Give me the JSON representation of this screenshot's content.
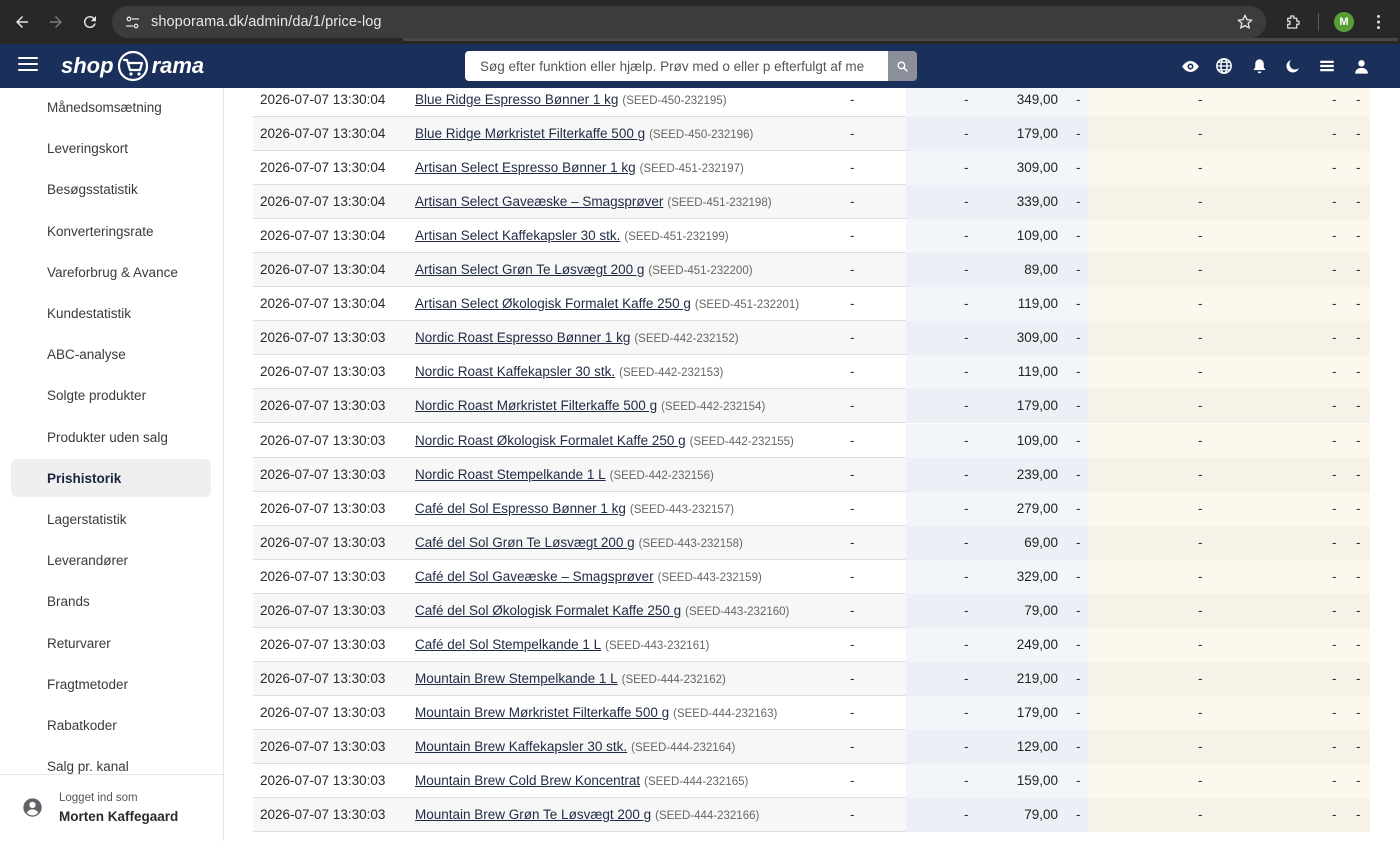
{
  "browser": {
    "url": "shoporama.dk/admin/da/1/price-log",
    "profile_initial": "M"
  },
  "header": {
    "logo_left": "shop",
    "logo_right": "rama",
    "search_placeholder": "Søg efter funktion eller hjælp. Prøv med o eller p efterfulgt af me",
    "icons": [
      "eye-icon",
      "globe-icon",
      "bell-icon",
      "moon-icon",
      "layers-icon",
      "user-icon"
    ],
    "colors": {
      "header_bg": "#1a2f5a",
      "browser_bg": "#282828"
    }
  },
  "sidebar": {
    "items": [
      {
        "label": "Månedsomsætning",
        "active": false
      },
      {
        "label": "Leveringskort",
        "active": false
      },
      {
        "label": "Besøgsstatistik",
        "active": false
      },
      {
        "label": "Konverteringsrate",
        "active": false
      },
      {
        "label": "Vareforbrug & Avance",
        "active": false
      },
      {
        "label": "Kundestatistik",
        "active": false
      },
      {
        "label": "ABC-analyse",
        "active": false
      },
      {
        "label": "Solgte produkter",
        "active": false
      },
      {
        "label": "Produkter uden salg",
        "active": false
      },
      {
        "label": "Prishistorik",
        "active": true
      },
      {
        "label": "Lagerstatistik",
        "active": false
      },
      {
        "label": "Leverandører",
        "active": false
      },
      {
        "label": "Brands",
        "active": false
      },
      {
        "label": "Returvarer",
        "active": false
      },
      {
        "label": "Fragtmetoder",
        "active": false
      },
      {
        "label": "Rabatkoder",
        "active": false
      },
      {
        "label": "Salg pr. kanal",
        "active": false
      }
    ],
    "user": {
      "label": "Logget ind som",
      "name": "Morten Kaffegaard"
    }
  },
  "table": {
    "dash": "-",
    "rows": [
      {
        "date": "2026-07-07 13:30:04",
        "product": "Blue Ridge Espresso Bønner 1 kg",
        "sku": "(SEED-450-232195)",
        "price": "349,00"
      },
      {
        "date": "2026-07-07 13:30:04",
        "product": "Blue Ridge Mørkristet Filterkaffe 500 g",
        "sku": "(SEED-450-232196)",
        "price": "179,00"
      },
      {
        "date": "2026-07-07 13:30:04",
        "product": "Artisan Select Espresso Bønner 1 kg",
        "sku": "(SEED-451-232197)",
        "price": "309,00"
      },
      {
        "date": "2026-07-07 13:30:04",
        "product": "Artisan Select Gaveæske – Smagsprøver",
        "sku": "(SEED-451-232198)",
        "price": "339,00"
      },
      {
        "date": "2026-07-07 13:30:04",
        "product": "Artisan Select Kaffekapsler 30 stk.",
        "sku": "(SEED-451-232199)",
        "price": "109,00"
      },
      {
        "date": "2026-07-07 13:30:04",
        "product": "Artisan Select Grøn Te Løsvægt 200 g",
        "sku": "(SEED-451-232200)",
        "price": "89,00"
      },
      {
        "date": "2026-07-07 13:30:04",
        "product": "Artisan Select Økologisk Formalet Kaffe 250 g",
        "sku": "(SEED-451-232201)",
        "price": "119,00"
      },
      {
        "date": "2026-07-07 13:30:03",
        "product": "Nordic Roast Espresso Bønner 1 kg",
        "sku": "(SEED-442-232152)",
        "price": "309,00"
      },
      {
        "date": "2026-07-07 13:30:03",
        "product": "Nordic Roast Kaffekapsler 30 stk.",
        "sku": "(SEED-442-232153)",
        "price": "119,00"
      },
      {
        "date": "2026-07-07 13:30:03",
        "product": "Nordic Roast Mørkristet Filterkaffe 500 g",
        "sku": "(SEED-442-232154)",
        "price": "179,00"
      },
      {
        "date": "2026-07-07 13:30:03",
        "product": "Nordic Roast Økologisk Formalet Kaffe 250 g",
        "sku": "(SEED-442-232155)",
        "price": "109,00"
      },
      {
        "date": "2026-07-07 13:30:03",
        "product": "Nordic Roast Stempelkande 1 L",
        "sku": "(SEED-442-232156)",
        "price": "239,00"
      },
      {
        "date": "2026-07-07 13:30:03",
        "product": "Café del Sol Espresso Bønner 1 kg",
        "sku": "(SEED-443-232157)",
        "price": "279,00"
      },
      {
        "date": "2026-07-07 13:30:03",
        "product": "Café del Sol Grøn Te Løsvægt 200 g",
        "sku": "(SEED-443-232158)",
        "price": "69,00"
      },
      {
        "date": "2026-07-07 13:30:03",
        "product": "Café del Sol Gaveæske – Smagsprøver",
        "sku": "(SEED-443-232159)",
        "price": "329,00"
      },
      {
        "date": "2026-07-07 13:30:03",
        "product": "Café del Sol Økologisk Formalet Kaffe 250 g",
        "sku": "(SEED-443-232160)",
        "price": "79,00"
      },
      {
        "date": "2026-07-07 13:30:03",
        "product": "Café del Sol Stempelkande 1 L",
        "sku": "(SEED-443-232161)",
        "price": "249,00"
      },
      {
        "date": "2026-07-07 13:30:03",
        "product": "Mountain Brew Stempelkande 1 L",
        "sku": "(SEED-444-232162)",
        "price": "219,00"
      },
      {
        "date": "2026-07-07 13:30:03",
        "product": "Mountain Brew Mørkristet Filterkaffe 500 g",
        "sku": "(SEED-444-232163)",
        "price": "179,00"
      },
      {
        "date": "2026-07-07 13:30:03",
        "product": "Mountain Brew Kaffekapsler 30 stk.",
        "sku": "(SEED-444-232164)",
        "price": "129,00"
      },
      {
        "date": "2026-07-07 13:30:03",
        "product": "Mountain Brew Cold Brew Koncentrat",
        "sku": "(SEED-444-232165)",
        "price": "159,00"
      },
      {
        "date": "2026-07-07 13:30:03",
        "product": "Mountain Brew Grøn Te Løsvægt 200 g",
        "sku": "(SEED-444-232166)",
        "price": "79,00"
      }
    ]
  }
}
